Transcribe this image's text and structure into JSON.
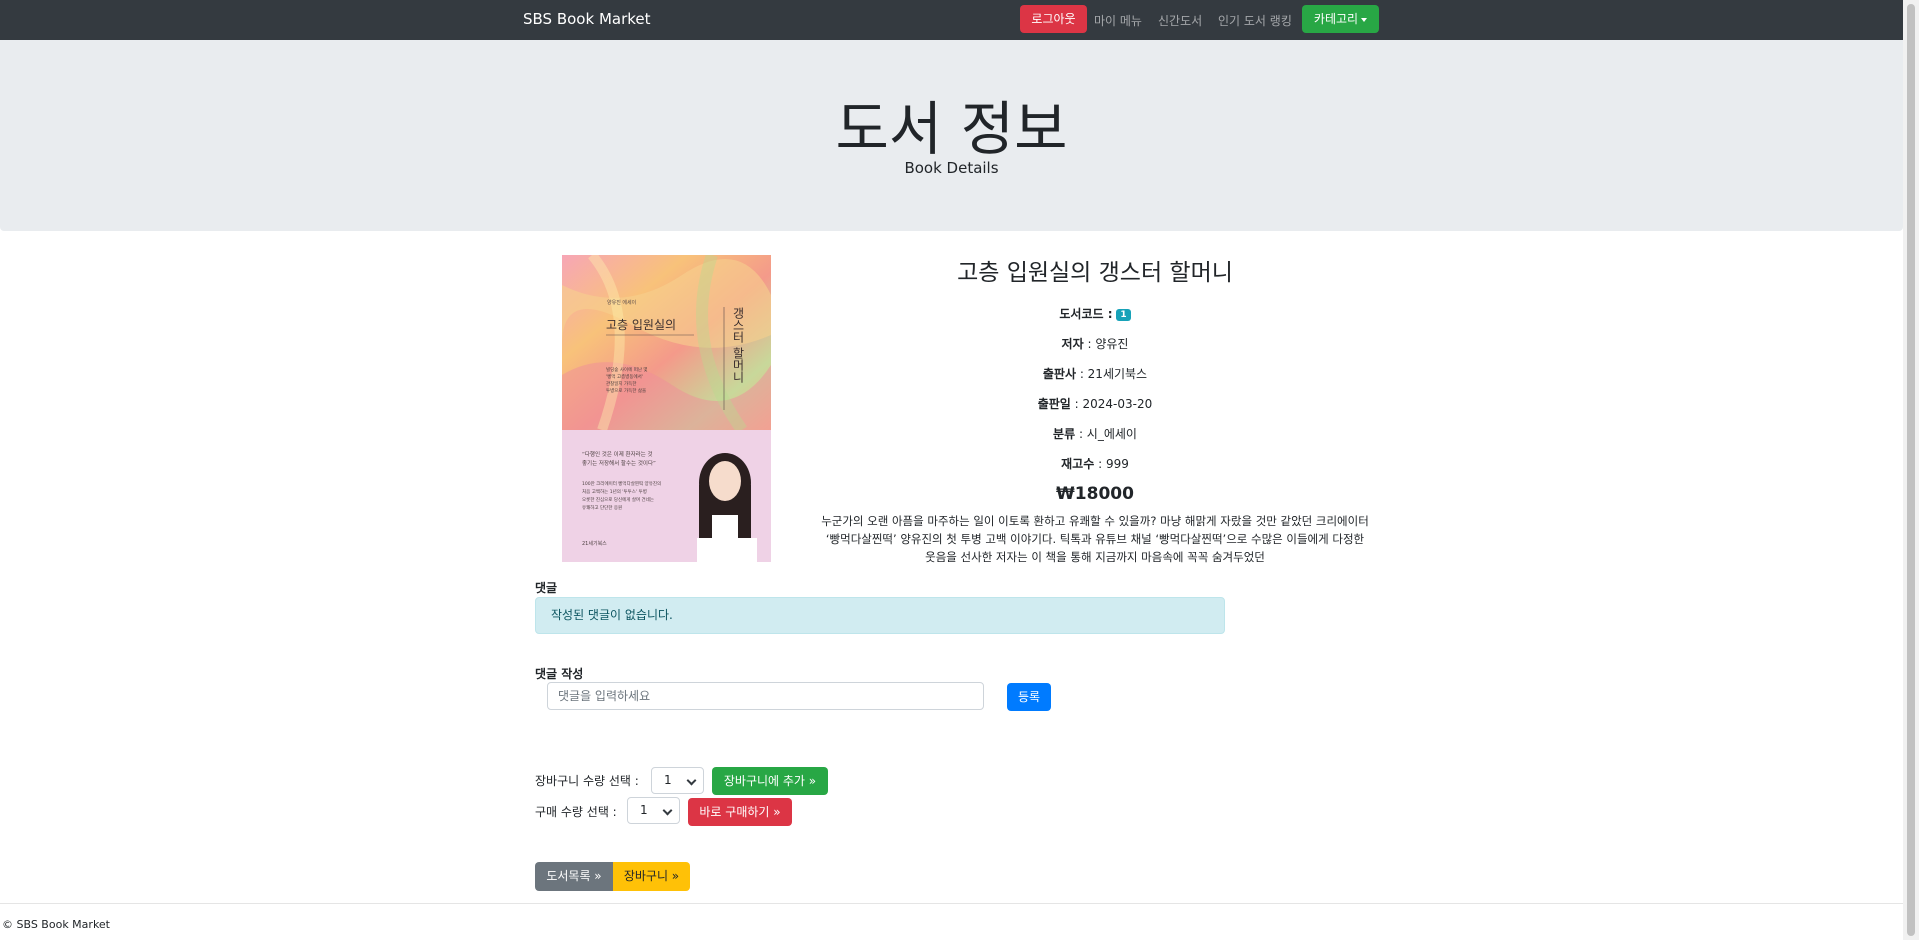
{
  "navbar": {
    "brand": "SBS Book Market",
    "logout_label": "로그아웃",
    "links": [
      "마이 메뉴",
      "신간도서",
      "인기 도서 랭킹"
    ],
    "category_label": "카테고리"
  },
  "jumbotron": {
    "title": "도서 정보",
    "subtitle": "Book Details"
  },
  "book": {
    "title": "고층 입원실의 갱스터 할머니",
    "code_label": "도서코드 :",
    "code": "1",
    "author_label": "저자",
    "author": "양유진",
    "publisher_label": "출판사",
    "publisher": "21세기북스",
    "pub_date_label": "출판일",
    "pub_date": "2024-03-20",
    "category_label": "분류",
    "category": "시_에세이",
    "stock_label": "재고수",
    "stock": "999",
    "price": "₩18000",
    "description": "누군가의 오랜 아픔을 마주하는 일이 이토록 환하고 유쾌할 수 있을까? 마냥 해맑게 자랐을 것만 같았던 크리에이터 ‘빵먹다살찐떡’ 양유진의 첫 투병 고백 이야기다. 틱톡과 유튜브 채널 ‘빵먹다살찐떡’으로 수많은 이들에게 다정한 웃음을 선사한 저자는 이 책을 통해 지금까지 마음속에 꼭꼭 숨겨두었던",
    "cover": {
      "small_text": "양유진 에세이",
      "title_left": "고층 입원실의",
      "title_right": "갱스터 할머니",
      "blurb": [
        "빌딩숲 사이에 떠난 몇",
        "'빵먹 고층병동에서'",
        "관찰일지 가득한",
        "투병으로 가득한 삶을"
      ],
      "quote": [
        "“다행인 것은 이제 환자라는 것",
        "좋기는 저장해서 할수는 것이다”"
      ],
      "lower_text": [
        "100만 크리에이터 빵먹다살찐떡 양유진의",
        "처음 고백하는 1년의 '투투스' 투병",
        "오롯한 진심으로 당신에게 살며 건네는",
        "유쾌하고 단단한 응원"
      ],
      "publisher_mark": "21세기북스",
      "colors": {
        "top": "#f3b08a",
        "bottom": "#efd2e6"
      }
    }
  },
  "comments": {
    "section_label": "댓글",
    "empty_message": "작성된 댓글이 없습니다.",
    "write_label": "댓글 작성",
    "input_placeholder": "댓글을 입력하세요",
    "submit_label": "등록"
  },
  "cart": {
    "qty_label": "장바구니 수량 선택 :",
    "qty_value": "1",
    "add_label": "장바구니에 추가 »"
  },
  "order": {
    "qty_label": "구매 수량 선택 :",
    "qty_value": "1",
    "buy_label": "바로 구매하기 »"
  },
  "actions": {
    "list_label": "도서목록 »",
    "cart_label": "장바구니 »"
  },
  "footer": {
    "text": "© SBS Book Market"
  }
}
